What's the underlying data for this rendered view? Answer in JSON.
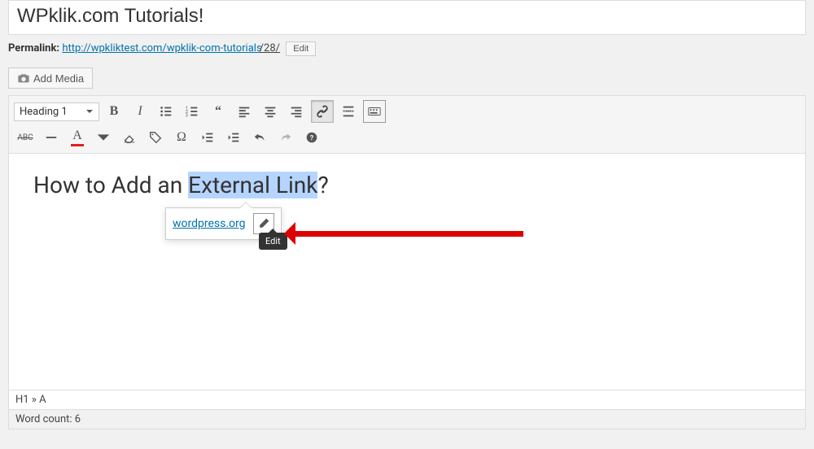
{
  "title": "WPklik.com Tutorials!",
  "permalink": {
    "label": "Permalink:",
    "url_pre": "http://wpkliktest.com/wpklik-com-tutorials",
    "url_id": "/28/",
    "edit_label": "Edit"
  },
  "add_media_label": "Add Media",
  "format_select": "Heading 1",
  "content": {
    "h1_pre": "How to Add an ",
    "h1_sel": "External Link",
    "h1_post": "?"
  },
  "link_popover": {
    "url": "wordpress.org",
    "tooltip": "Edit"
  },
  "status_path": "H1 » A",
  "word_count_label": "Word count: 6",
  "row1_labels": [
    "Bold",
    "Italic",
    "Bulleted list",
    "Numbered list",
    "Quote",
    "Align left",
    "Align center",
    "Align right",
    "Insert link",
    "Readmore",
    "Toolbar"
  ],
  "row2_labels": [
    "Strikethrough",
    "Line",
    "Text color",
    "Clear",
    "Tag",
    "Spec char",
    "Outdent",
    "Indent",
    "Undo",
    "Redo",
    "Help"
  ]
}
